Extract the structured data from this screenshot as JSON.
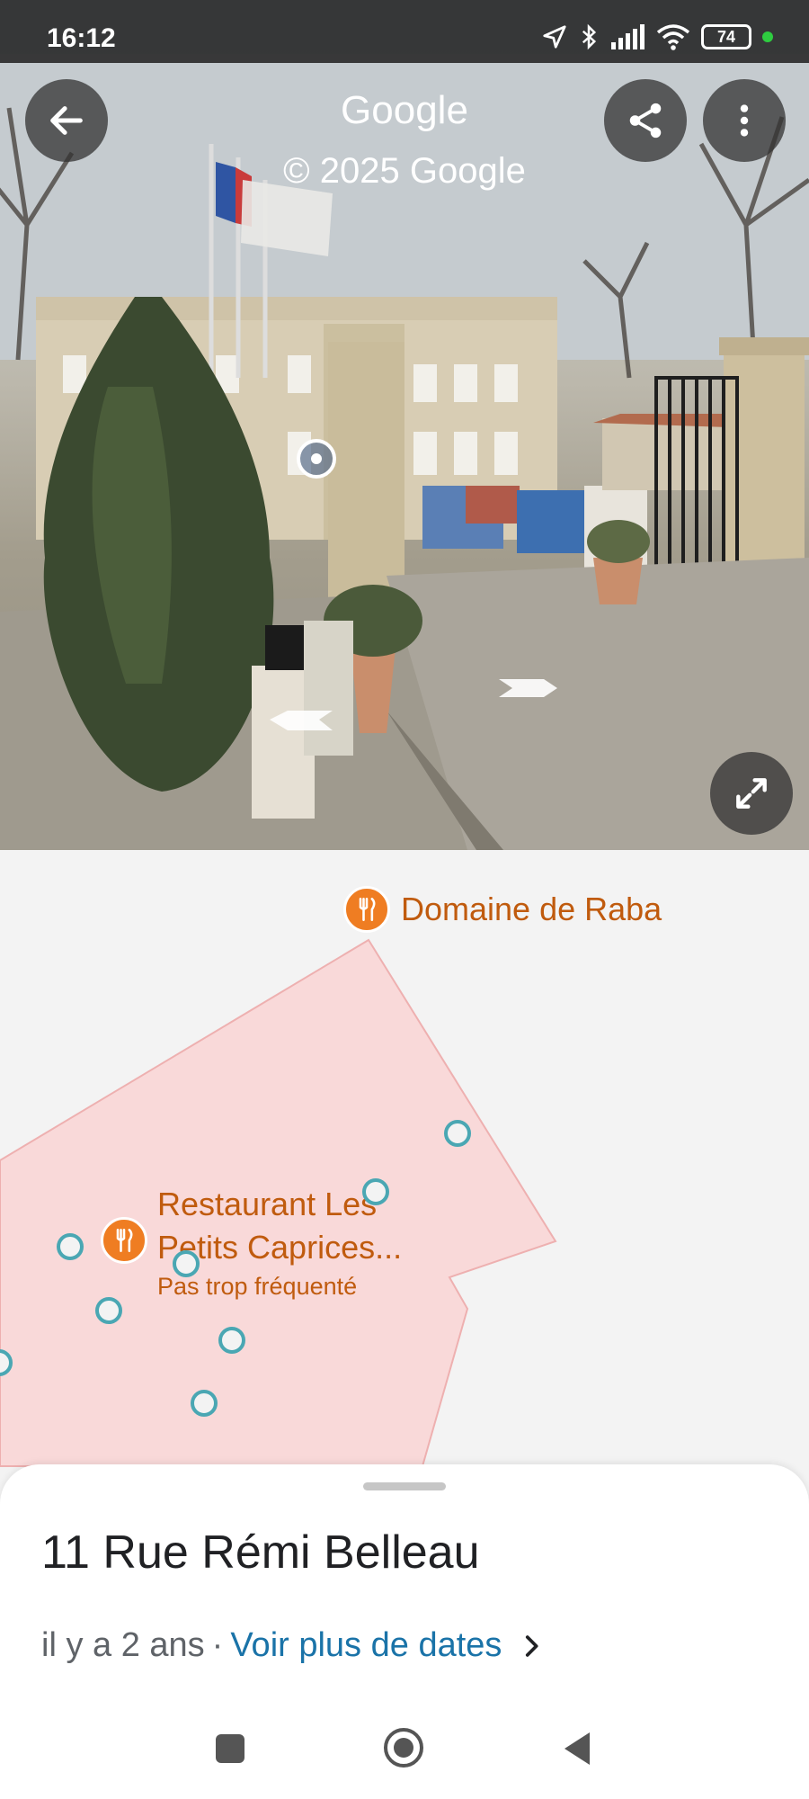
{
  "status_bar": {
    "time": "16:12",
    "battery": "74"
  },
  "header": {
    "title": "Google",
    "copyright": "© 2025 Google"
  },
  "map": {
    "poi_1": {
      "name": "Domaine de Raba"
    },
    "poi_2": {
      "name_line1": "Restaurant Les",
      "name_line2": "Petits Caprices...",
      "subtitle": "Pas trop fréquenté"
    }
  },
  "sheet": {
    "address": "11 Rue Rémi Belleau",
    "date_text": "il y a 2 ans",
    "separator": "·",
    "more_dates_link": "Voir plus de dates"
  },
  "colors": {
    "poi_orange": "#ef7d22",
    "link_blue": "#1a73a8",
    "area_pink": "#f9d9d9",
    "transit_teal": "#4aa7b3"
  },
  "icons": [
    "arrow-back-icon",
    "share-icon",
    "more-vert-icon",
    "expand-icon",
    "restaurant-icon",
    "chevron-right-icon",
    "location-icon",
    "bluetooth-icon",
    "signal-icon",
    "wifi-icon"
  ]
}
